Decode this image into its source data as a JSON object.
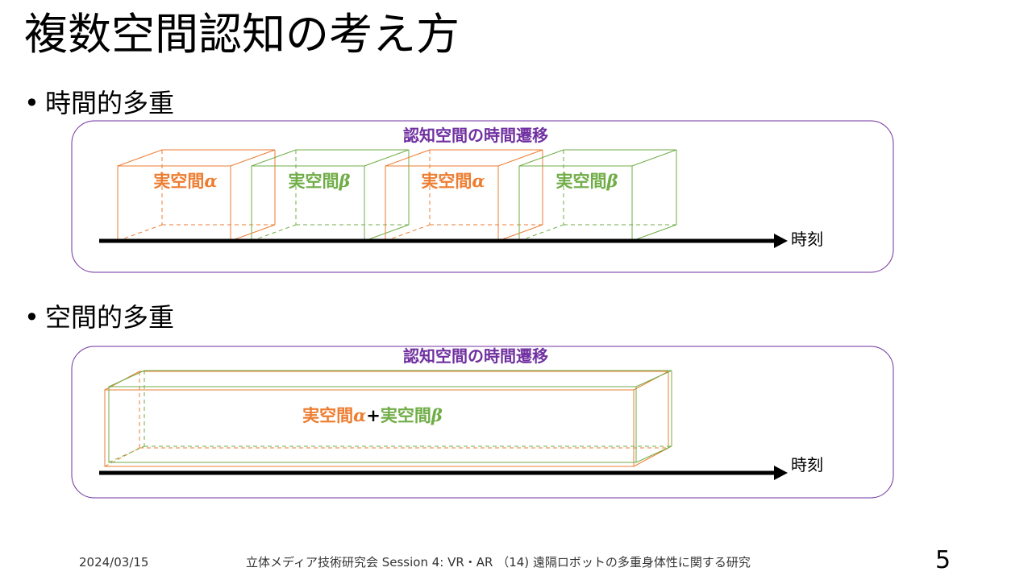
{
  "slide": {
    "title": "複数空間認知の考え方",
    "bullet_marker": "•",
    "bullets": [
      "時間的多重",
      "空間的多重"
    ]
  },
  "temporal": {
    "frame_label": "認知空間の時間遷移",
    "axis_label": "時刻",
    "cubes": [
      {
        "label_text": "実空間",
        "symbol": "α",
        "color": "#ed7d31"
      },
      {
        "label_text": "実空間",
        "symbol": "β",
        "color": "#70ad47"
      },
      {
        "label_text": "実空間",
        "symbol": "α",
        "color": "#ed7d31"
      },
      {
        "label_text": "実空間",
        "symbol": "β",
        "color": "#70ad47"
      }
    ]
  },
  "spatial": {
    "frame_label": "認知空間の時間遷移",
    "axis_label": "時刻",
    "label_part1_text": "実空間",
    "label_part1_symbol": "α",
    "label_plus": "+",
    "label_part2_text": "実空間",
    "label_part2_symbol": "β"
  },
  "colors": {
    "alpha": "#ed7d31",
    "beta": "#70ad47",
    "frame": "#7030a0",
    "arrow": "#000000"
  },
  "footer": {
    "date": "2024/03/15",
    "center_text": "立体メディア技術研究会 Session 4: VR・AR （14) 遠隔ロボットの多重身体性に関する研究",
    "page_number": "5"
  }
}
